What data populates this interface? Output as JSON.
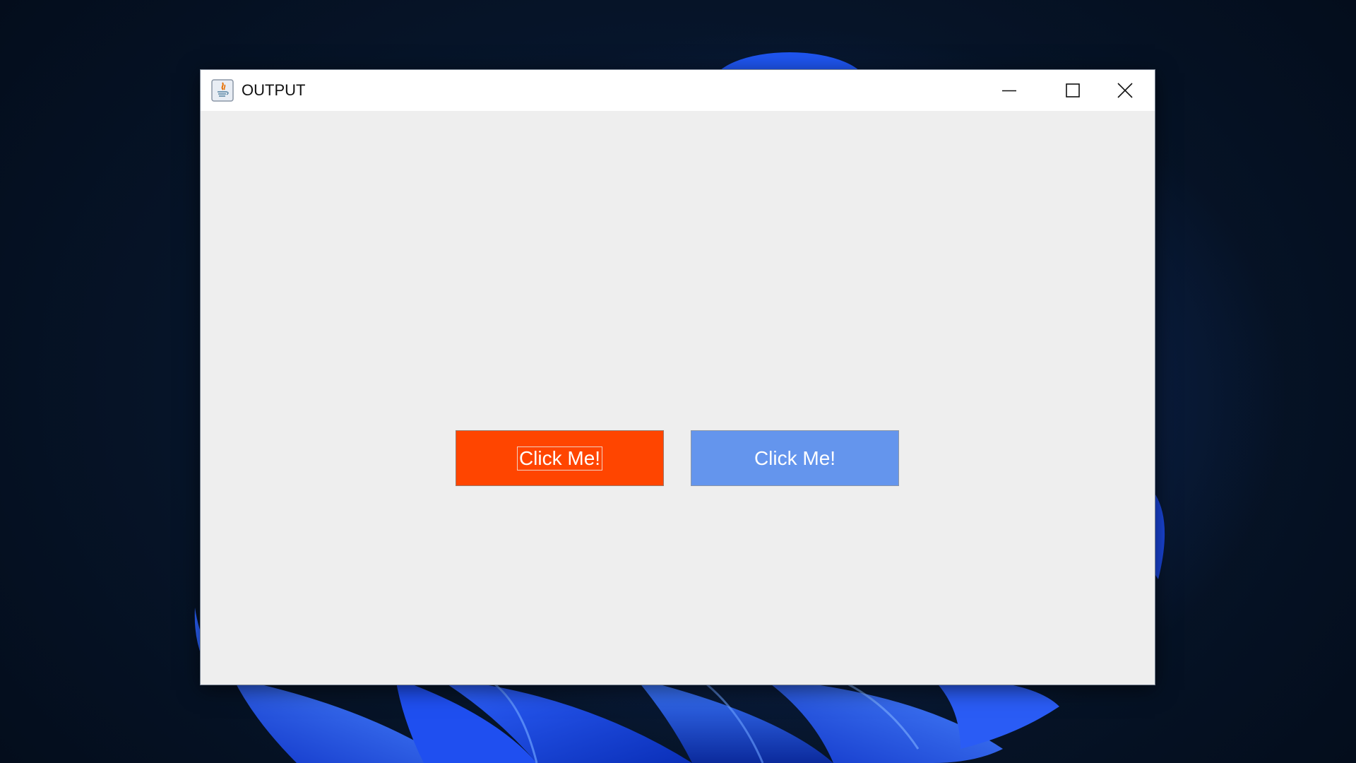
{
  "window": {
    "title": "OUTPUT",
    "icon": "java-icon"
  },
  "controls": {
    "minimize": "minimize-icon",
    "maximize": "maximize-icon",
    "close": "close-icon"
  },
  "buttons": [
    {
      "label": "Click Me!",
      "background": "#ff4500",
      "text_color": "#ffffff",
      "focused": true
    },
    {
      "label": "Click Me!",
      "background": "#6495ed",
      "text_color": "#ffffff",
      "focused": false
    }
  ]
}
